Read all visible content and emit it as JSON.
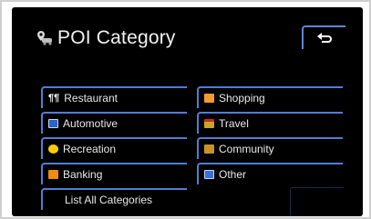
{
  "header": {
    "title": "POI Category",
    "title_icon": "map-pin-car-icon",
    "back_icon": "return-arrow-icon"
  },
  "categories": [
    {
      "label": "Restaurant",
      "icon": "fork-knife-icon"
    },
    {
      "label": "Shopping",
      "icon": "shopping-icon"
    },
    {
      "label": "Automotive",
      "icon": "car-icon"
    },
    {
      "label": "Travel",
      "icon": "travel-icon"
    },
    {
      "label": "Recreation",
      "icon": "smiley-icon"
    },
    {
      "label": "Community",
      "icon": "community-icon"
    },
    {
      "label": "Banking",
      "icon": "bank-icon"
    },
    {
      "label": "Other",
      "icon": "other-icon"
    }
  ],
  "footer": {
    "list_all_label": "List All Categories"
  },
  "colors": {
    "screen_bg": "#000000",
    "button_border": "#4f7ed6",
    "text": "#e8e8e8"
  }
}
